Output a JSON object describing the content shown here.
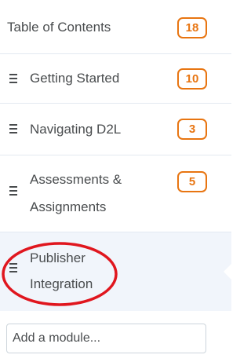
{
  "toc": {
    "title": "Table of Contents",
    "count": "18"
  },
  "modules": [
    {
      "label": "Getting Started",
      "count": "10"
    },
    {
      "label": "Navigating D2L",
      "count": "3"
    },
    {
      "label_line1": "Assessments &",
      "label_line2": "Assignments",
      "count": "5"
    },
    {
      "label_line1": "Publisher",
      "label_line2": "Integration"
    }
  ],
  "add_module": {
    "label": "Add a module..."
  },
  "colors": {
    "badge_accent": "#e87511",
    "selected_background": "#f1f5fb",
    "annotation_circle": "#e0161e",
    "text": "#494c4e",
    "divider": "#e3e9f1"
  },
  "icons": {
    "drag_handle": "drag-handle-icon",
    "selection_indicator": "selection-notch-icon"
  }
}
